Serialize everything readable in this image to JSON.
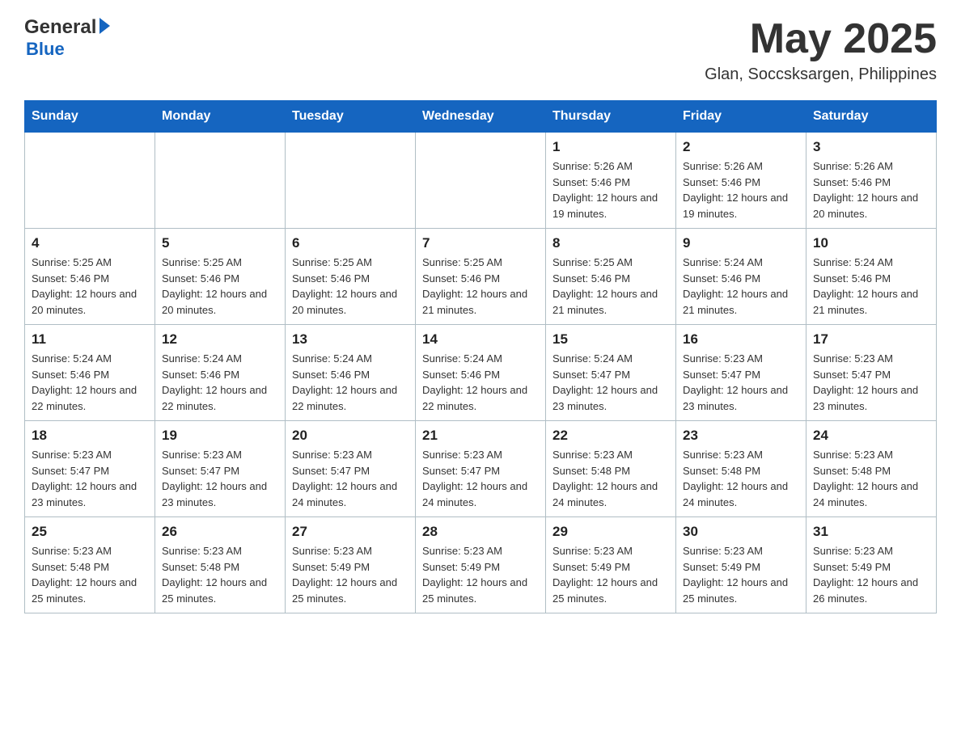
{
  "header": {
    "logo_general": "General",
    "logo_blue": "Blue",
    "month_year": "May 2025",
    "location": "Glan, Soccsksargen, Philippines"
  },
  "weekdays": [
    "Sunday",
    "Monday",
    "Tuesday",
    "Wednesday",
    "Thursday",
    "Friday",
    "Saturday"
  ],
  "weeks": [
    [
      {
        "day": "",
        "sunrise": "",
        "sunset": "",
        "daylight": ""
      },
      {
        "day": "",
        "sunrise": "",
        "sunset": "",
        "daylight": ""
      },
      {
        "day": "",
        "sunrise": "",
        "sunset": "",
        "daylight": ""
      },
      {
        "day": "",
        "sunrise": "",
        "sunset": "",
        "daylight": ""
      },
      {
        "day": "1",
        "sunrise": "Sunrise: 5:26 AM",
        "sunset": "Sunset: 5:46 PM",
        "daylight": "Daylight: 12 hours and 19 minutes."
      },
      {
        "day": "2",
        "sunrise": "Sunrise: 5:26 AM",
        "sunset": "Sunset: 5:46 PM",
        "daylight": "Daylight: 12 hours and 19 minutes."
      },
      {
        "day": "3",
        "sunrise": "Sunrise: 5:26 AM",
        "sunset": "Sunset: 5:46 PM",
        "daylight": "Daylight: 12 hours and 20 minutes."
      }
    ],
    [
      {
        "day": "4",
        "sunrise": "Sunrise: 5:25 AM",
        "sunset": "Sunset: 5:46 PM",
        "daylight": "Daylight: 12 hours and 20 minutes."
      },
      {
        "day": "5",
        "sunrise": "Sunrise: 5:25 AM",
        "sunset": "Sunset: 5:46 PM",
        "daylight": "Daylight: 12 hours and 20 minutes."
      },
      {
        "day": "6",
        "sunrise": "Sunrise: 5:25 AM",
        "sunset": "Sunset: 5:46 PM",
        "daylight": "Daylight: 12 hours and 20 minutes."
      },
      {
        "day": "7",
        "sunrise": "Sunrise: 5:25 AM",
        "sunset": "Sunset: 5:46 PM",
        "daylight": "Daylight: 12 hours and 21 minutes."
      },
      {
        "day": "8",
        "sunrise": "Sunrise: 5:25 AM",
        "sunset": "Sunset: 5:46 PM",
        "daylight": "Daylight: 12 hours and 21 minutes."
      },
      {
        "day": "9",
        "sunrise": "Sunrise: 5:24 AM",
        "sunset": "Sunset: 5:46 PM",
        "daylight": "Daylight: 12 hours and 21 minutes."
      },
      {
        "day": "10",
        "sunrise": "Sunrise: 5:24 AM",
        "sunset": "Sunset: 5:46 PM",
        "daylight": "Daylight: 12 hours and 21 minutes."
      }
    ],
    [
      {
        "day": "11",
        "sunrise": "Sunrise: 5:24 AM",
        "sunset": "Sunset: 5:46 PM",
        "daylight": "Daylight: 12 hours and 22 minutes."
      },
      {
        "day": "12",
        "sunrise": "Sunrise: 5:24 AM",
        "sunset": "Sunset: 5:46 PM",
        "daylight": "Daylight: 12 hours and 22 minutes."
      },
      {
        "day": "13",
        "sunrise": "Sunrise: 5:24 AM",
        "sunset": "Sunset: 5:46 PM",
        "daylight": "Daylight: 12 hours and 22 minutes."
      },
      {
        "day": "14",
        "sunrise": "Sunrise: 5:24 AM",
        "sunset": "Sunset: 5:46 PM",
        "daylight": "Daylight: 12 hours and 22 minutes."
      },
      {
        "day": "15",
        "sunrise": "Sunrise: 5:24 AM",
        "sunset": "Sunset: 5:47 PM",
        "daylight": "Daylight: 12 hours and 23 minutes."
      },
      {
        "day": "16",
        "sunrise": "Sunrise: 5:23 AM",
        "sunset": "Sunset: 5:47 PM",
        "daylight": "Daylight: 12 hours and 23 minutes."
      },
      {
        "day": "17",
        "sunrise": "Sunrise: 5:23 AM",
        "sunset": "Sunset: 5:47 PM",
        "daylight": "Daylight: 12 hours and 23 minutes."
      }
    ],
    [
      {
        "day": "18",
        "sunrise": "Sunrise: 5:23 AM",
        "sunset": "Sunset: 5:47 PM",
        "daylight": "Daylight: 12 hours and 23 minutes."
      },
      {
        "day": "19",
        "sunrise": "Sunrise: 5:23 AM",
        "sunset": "Sunset: 5:47 PM",
        "daylight": "Daylight: 12 hours and 23 minutes."
      },
      {
        "day": "20",
        "sunrise": "Sunrise: 5:23 AM",
        "sunset": "Sunset: 5:47 PM",
        "daylight": "Daylight: 12 hours and 24 minutes."
      },
      {
        "day": "21",
        "sunrise": "Sunrise: 5:23 AM",
        "sunset": "Sunset: 5:47 PM",
        "daylight": "Daylight: 12 hours and 24 minutes."
      },
      {
        "day": "22",
        "sunrise": "Sunrise: 5:23 AM",
        "sunset": "Sunset: 5:48 PM",
        "daylight": "Daylight: 12 hours and 24 minutes."
      },
      {
        "day": "23",
        "sunrise": "Sunrise: 5:23 AM",
        "sunset": "Sunset: 5:48 PM",
        "daylight": "Daylight: 12 hours and 24 minutes."
      },
      {
        "day": "24",
        "sunrise": "Sunrise: 5:23 AM",
        "sunset": "Sunset: 5:48 PM",
        "daylight": "Daylight: 12 hours and 24 minutes."
      }
    ],
    [
      {
        "day": "25",
        "sunrise": "Sunrise: 5:23 AM",
        "sunset": "Sunset: 5:48 PM",
        "daylight": "Daylight: 12 hours and 25 minutes."
      },
      {
        "day": "26",
        "sunrise": "Sunrise: 5:23 AM",
        "sunset": "Sunset: 5:48 PM",
        "daylight": "Daylight: 12 hours and 25 minutes."
      },
      {
        "day": "27",
        "sunrise": "Sunrise: 5:23 AM",
        "sunset": "Sunset: 5:49 PM",
        "daylight": "Daylight: 12 hours and 25 minutes."
      },
      {
        "day": "28",
        "sunrise": "Sunrise: 5:23 AM",
        "sunset": "Sunset: 5:49 PM",
        "daylight": "Daylight: 12 hours and 25 minutes."
      },
      {
        "day": "29",
        "sunrise": "Sunrise: 5:23 AM",
        "sunset": "Sunset: 5:49 PM",
        "daylight": "Daylight: 12 hours and 25 minutes."
      },
      {
        "day": "30",
        "sunrise": "Sunrise: 5:23 AM",
        "sunset": "Sunset: 5:49 PM",
        "daylight": "Daylight: 12 hours and 25 minutes."
      },
      {
        "day": "31",
        "sunrise": "Sunrise: 5:23 AM",
        "sunset": "Sunset: 5:49 PM",
        "daylight": "Daylight: 12 hours and 26 minutes."
      }
    ]
  ]
}
